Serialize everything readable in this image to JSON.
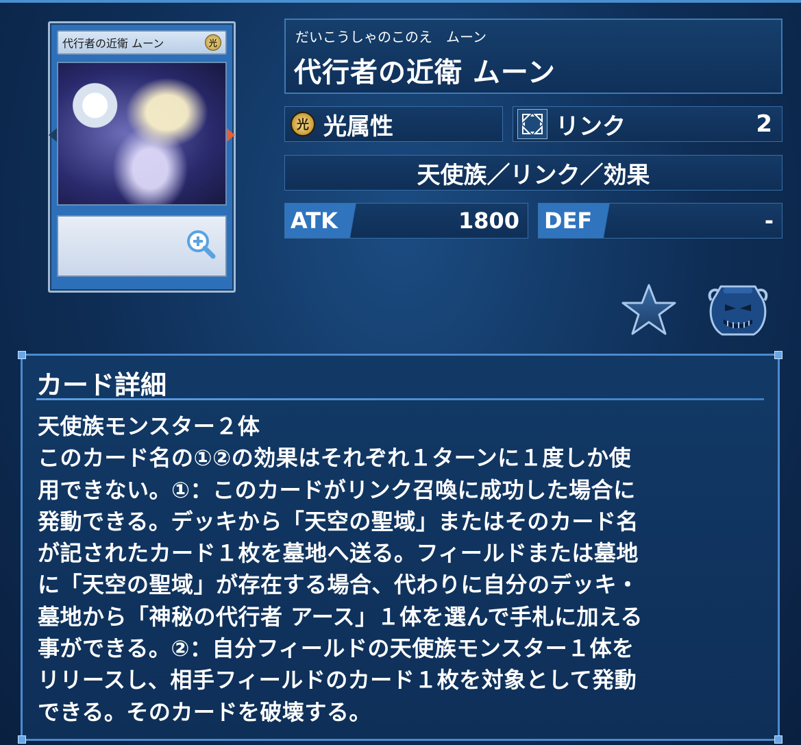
{
  "card": {
    "card_image_name": "代行者の近衛 ムーン",
    "card_image_attribute": "光",
    "zoom_icon": "zoom-in-icon"
  },
  "name": {
    "ruby": "だいこうしゃのこのえ　ムーン",
    "title": "代行者の近衛 ムーン"
  },
  "attribute": {
    "icon_glyph": "光",
    "label": "光属性"
  },
  "link": {
    "label": "リンク",
    "value": "2"
  },
  "type_line": "天使族／リンク／効果",
  "stats": {
    "atk_label": "ATK",
    "atk_value": "1800",
    "def_label": "DEF",
    "def_value": "-"
  },
  "actions": {
    "favorite_icon": "star-icon",
    "pot_icon": "pot-of-greed-icon"
  },
  "detail": {
    "title": "カード詳細",
    "text": "天使族モンスター２体\nこのカード名の①②の効果はそれぞれ１ターンに１度しか使\n用できない。①：このカードがリンク召喚に成功した場合に\n発動できる。デッキから「天空の聖域」またはそのカード名\nが記されたカード１枚を墓地へ送る。フィールドまたは墓地\nに「天空の聖域」が存在する場合、代わりに自分のデッキ・\n墓地から「神秘の代行者 アース」１体を選んで手札に加える\n事ができる。②：自分フィールドの天使族モンスター１体を\nリリースし、相手フィールドのカード１枚を対象として発動\nできる。そのカードを破壊する。"
  },
  "colors": {
    "background": "#0e2d55",
    "panel_border": "#3a6ea6",
    "stat_tag": "#2f74bd",
    "detail_border": "#4a8bd0"
  }
}
